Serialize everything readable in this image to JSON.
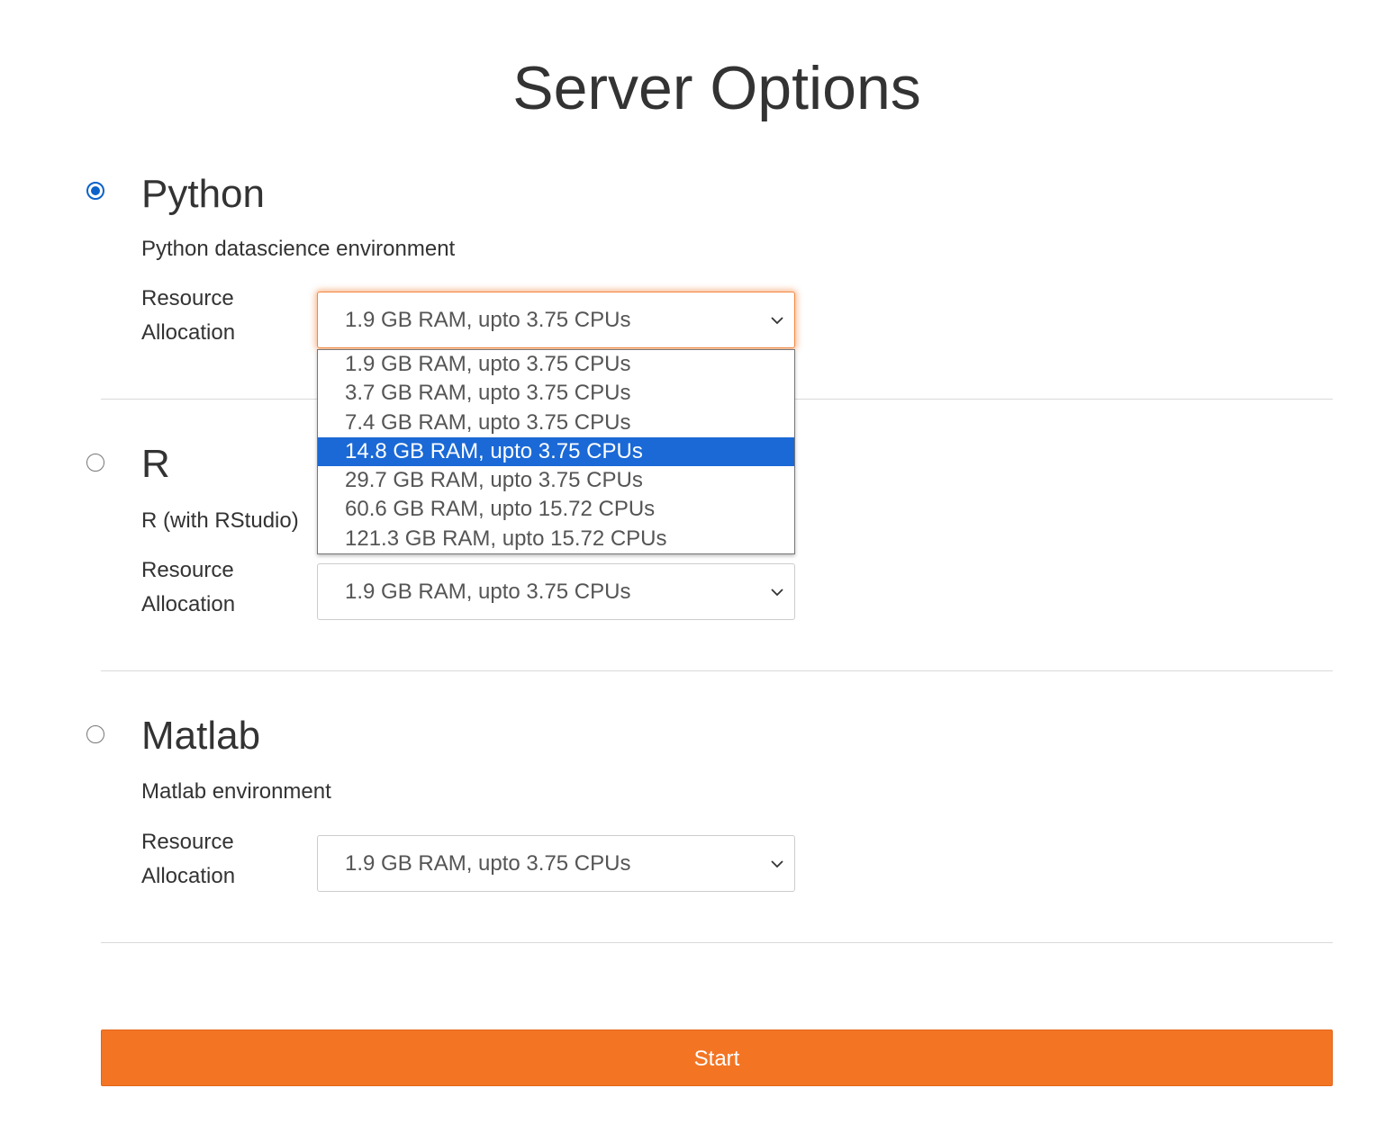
{
  "page": {
    "title": "Server Options"
  },
  "options": [
    {
      "name": "Python",
      "description": "Python datascience environment",
      "resource_label": "Resource Allocation",
      "selected_value": "1.9 GB RAM, upto 3.75 CPUs",
      "checked": true
    },
    {
      "name": "R",
      "description": "R (with RStudio)",
      "resource_label": "Resource Allocation",
      "selected_value": "1.9 GB RAM, upto 3.75 CPUs",
      "checked": false
    },
    {
      "name": "Matlab",
      "description": "Matlab environment",
      "resource_label": "Resource Allocation",
      "selected_value": "1.9 GB RAM, upto 3.75 CPUs",
      "checked": false
    }
  ],
  "dropdown": {
    "open_for": "Python",
    "highlighted_index": 3,
    "items": [
      "1.9 GB RAM, upto 3.75 CPUs",
      "3.7 GB RAM, upto 3.75 CPUs",
      "7.4 GB RAM, upto 3.75 CPUs",
      "14.8 GB RAM, upto 3.75 CPUs",
      "29.7 GB RAM, upto 3.75 CPUs",
      "60.6 GB RAM, upto 15.72 CPUs",
      "121.3 GB RAM, upto 15.72 CPUs"
    ]
  },
  "start_button": {
    "label": "Start"
  },
  "colors": {
    "accent": "#f37524",
    "radio_checked": "#0b62c9",
    "dropdown_highlight": "#1a69d6"
  },
  "icons": {
    "select_arrow": "chevron-down-icon"
  }
}
